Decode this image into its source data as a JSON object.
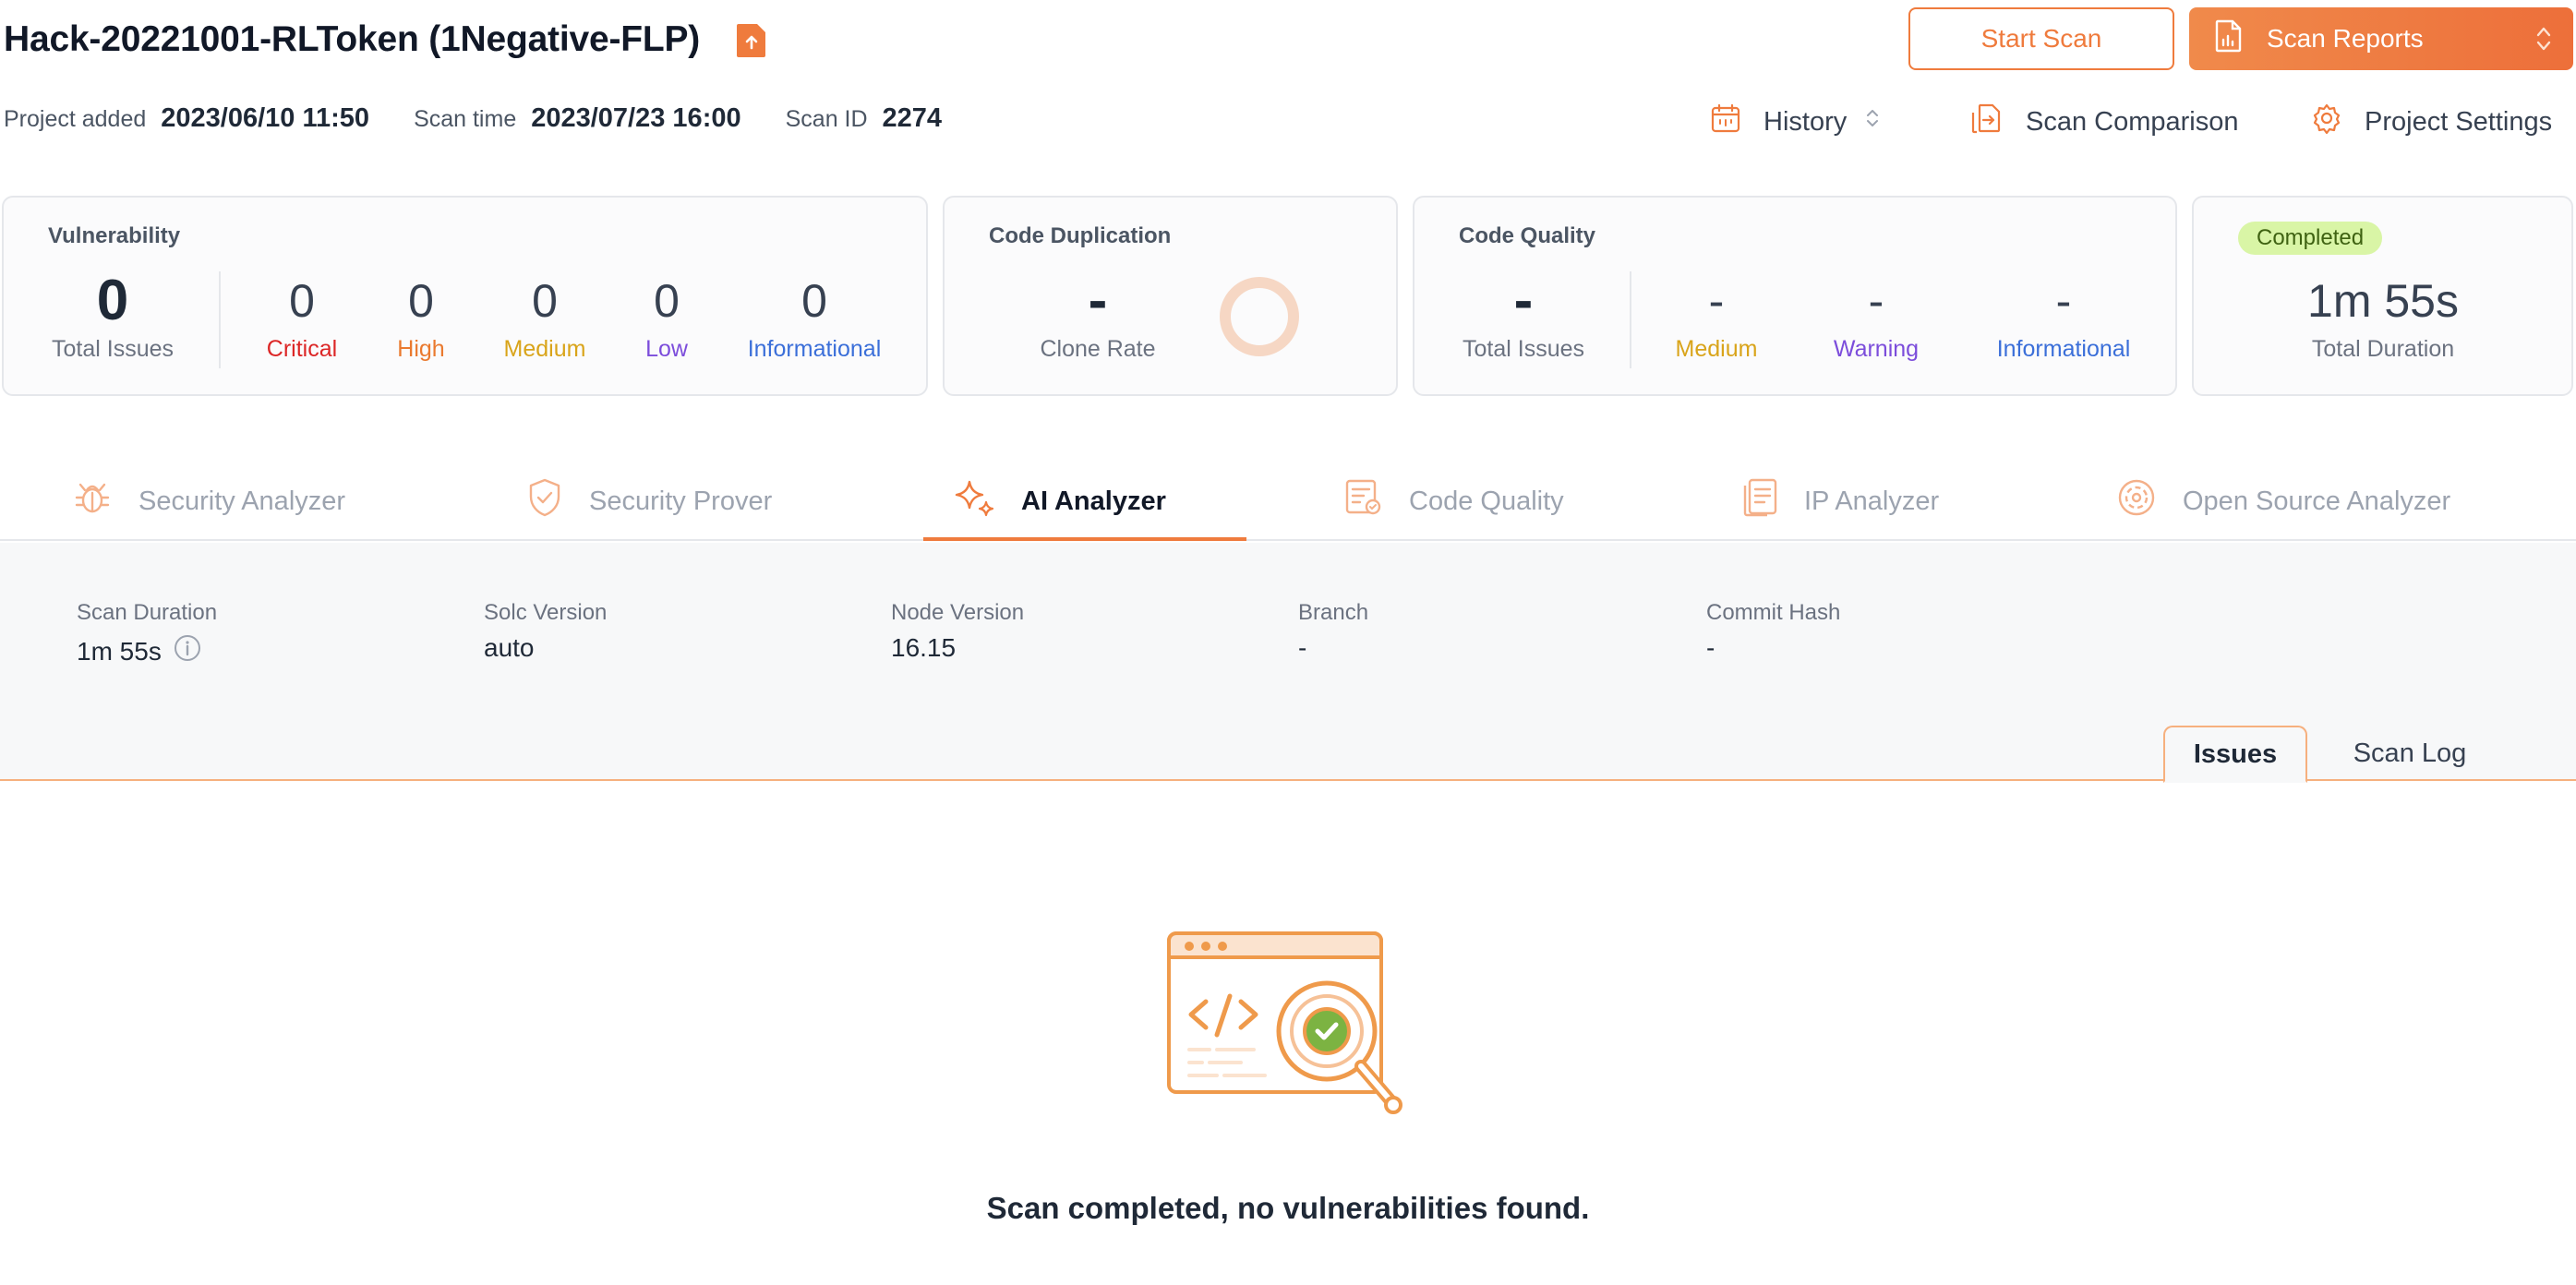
{
  "header": {
    "title": "Hack-20221001-RLToken (1Negative-FLP)",
    "upload_icon": "file-upload-icon",
    "start_scan_label": "Start Scan",
    "scan_reports_label": "Scan Reports"
  },
  "meta": {
    "project_added_label": "Project added",
    "project_added_value": "2023/06/10 11:50",
    "scan_time_label": "Scan time",
    "scan_time_value": "2023/07/23 16:00",
    "scan_id_label": "Scan ID",
    "scan_id_value": "2274"
  },
  "links": {
    "history": "History",
    "scan_comparison": "Scan Comparison",
    "project_settings": "Project Settings"
  },
  "cards": {
    "vulnerability": {
      "title": "Vulnerability",
      "total": "0",
      "total_label": "Total Issues",
      "critical": "0",
      "critical_label": "Critical",
      "high": "0",
      "high_label": "High",
      "medium": "0",
      "medium_label": "Medium",
      "low": "0",
      "low_label": "Low",
      "informational": "0",
      "informational_label": "Informational"
    },
    "duplication": {
      "title": "Code Duplication",
      "clone_rate": "-",
      "clone_rate_label": "Clone Rate"
    },
    "quality": {
      "title": "Code Quality",
      "total": "-",
      "total_label": "Total Issues",
      "medium": "-",
      "medium_label": "Medium",
      "warning": "-",
      "warning_label": "Warning",
      "informational": "-",
      "informational_label": "Informational"
    },
    "status": {
      "badge": "Completed",
      "duration": "1m 55s",
      "duration_label": "Total Duration"
    }
  },
  "tabs": [
    {
      "label": "Security Analyzer",
      "icon": "bug-icon"
    },
    {
      "label": "Security Prover",
      "icon": "shield-check-icon"
    },
    {
      "label": "AI Analyzer",
      "icon": "sparkle-icon"
    },
    {
      "label": "Code Quality",
      "icon": "code-quality-icon"
    },
    {
      "label": "IP Analyzer",
      "icon": "ip-document-icon"
    },
    {
      "label": "Open Source Analyzer",
      "icon": "open-source-icon"
    }
  ],
  "info": {
    "scan_duration_label": "Scan Duration",
    "scan_duration_value": "1m 55s",
    "solc_label": "Solc Version",
    "solc_value": "auto",
    "node_label": "Node Version",
    "node_value": "16.15",
    "branch_label": "Branch",
    "branch_value": "-",
    "commit_label": "Commit Hash",
    "commit_value": "-"
  },
  "subtabs": {
    "issues": "Issues",
    "scan_log": "Scan Log"
  },
  "empty": {
    "message": "Scan completed, no vulnerabilities found."
  },
  "colors": {
    "accent": "#ef7b3d",
    "critical": "#dc2626",
    "high": "#ea7a2f",
    "medium": "#d9a41a",
    "low": "#7c4ddb",
    "informational": "#3b6fd9",
    "completed_badge": "#d9f5a6"
  }
}
